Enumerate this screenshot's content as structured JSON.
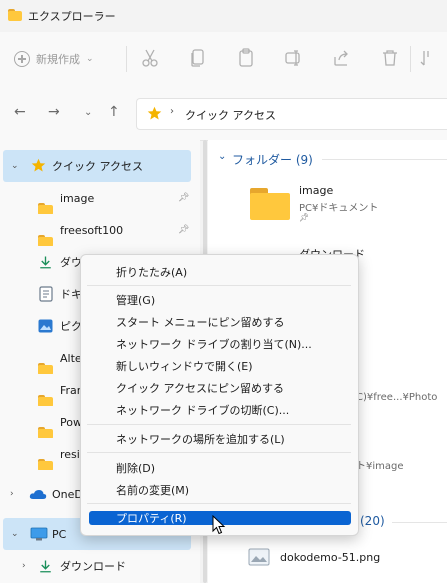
{
  "window": {
    "title": "エクスプローラー"
  },
  "command_bar": {
    "new_label": "新規作成",
    "icons": [
      "cut-icon",
      "copy-icon",
      "paste-icon",
      "rename-icon",
      "share-icon",
      "delete-icon",
      "sort-icon"
    ]
  },
  "address": {
    "path": "クイック アクセス"
  },
  "nav": {
    "items": [
      {
        "label": "クイック アクセス",
        "icon": "star-icon",
        "selected": true,
        "expanded": true
      },
      {
        "label": "image",
        "icon": "folder-icon",
        "pinned": true
      },
      {
        "label": "freesoft100",
        "icon": "folder-icon",
        "pinned": true
      },
      {
        "label": "ダウン",
        "icon": "download-icon"
      },
      {
        "label": "ドキ",
        "icon": "document-icon"
      },
      {
        "label": "ピク",
        "icon": "pictures-icon"
      },
      {
        "label": "Alte",
        "icon": "folder-icon"
      },
      {
        "label": "Fran",
        "icon": "folder-icon"
      },
      {
        "label": "Pow",
        "icon": "folder-icon"
      },
      {
        "label": "resiz",
        "icon": "folder-icon"
      },
      {
        "label": "OneD",
        "icon": "cloud-icon"
      },
      {
        "label": "PC",
        "icon": "pc-icon",
        "selected": true
      },
      {
        "label": "ダウンロード",
        "icon": "download-icon"
      }
    ]
  },
  "content": {
    "folders_header": "フォルダー (9)",
    "folder1_name": "image",
    "folder1_path": "PC¥ドキュメント",
    "folder2_name": "ダウンロード",
    "partial_path1": "C)¥free...¥Photo",
    "partial_path2": "ト¥image",
    "recent_header": "(20)",
    "recent_file": "dokodemo-51.png"
  },
  "context_menu": {
    "collapse": "折りたたみ(A)",
    "manage": "管理(G)",
    "pin_start": "スタート メニューにピン留めする",
    "map_drive": "ネットワーク ドライブの割り当て(N)...",
    "open_new_window": "新しいウィンドウで開く(E)",
    "pin_quick": "クイック アクセスにピン留めする",
    "disconnect_drive": "ネットワーク ドライブの切断(C)...",
    "add_network": "ネットワークの場所を追加する(L)",
    "delete": "削除(D)",
    "rename": "名前の変更(M)",
    "properties": "プロパティ(R)"
  },
  "colors": {
    "accent": "#0a64d2",
    "selection": "#cce4f7",
    "folder": "#ffc83d"
  }
}
